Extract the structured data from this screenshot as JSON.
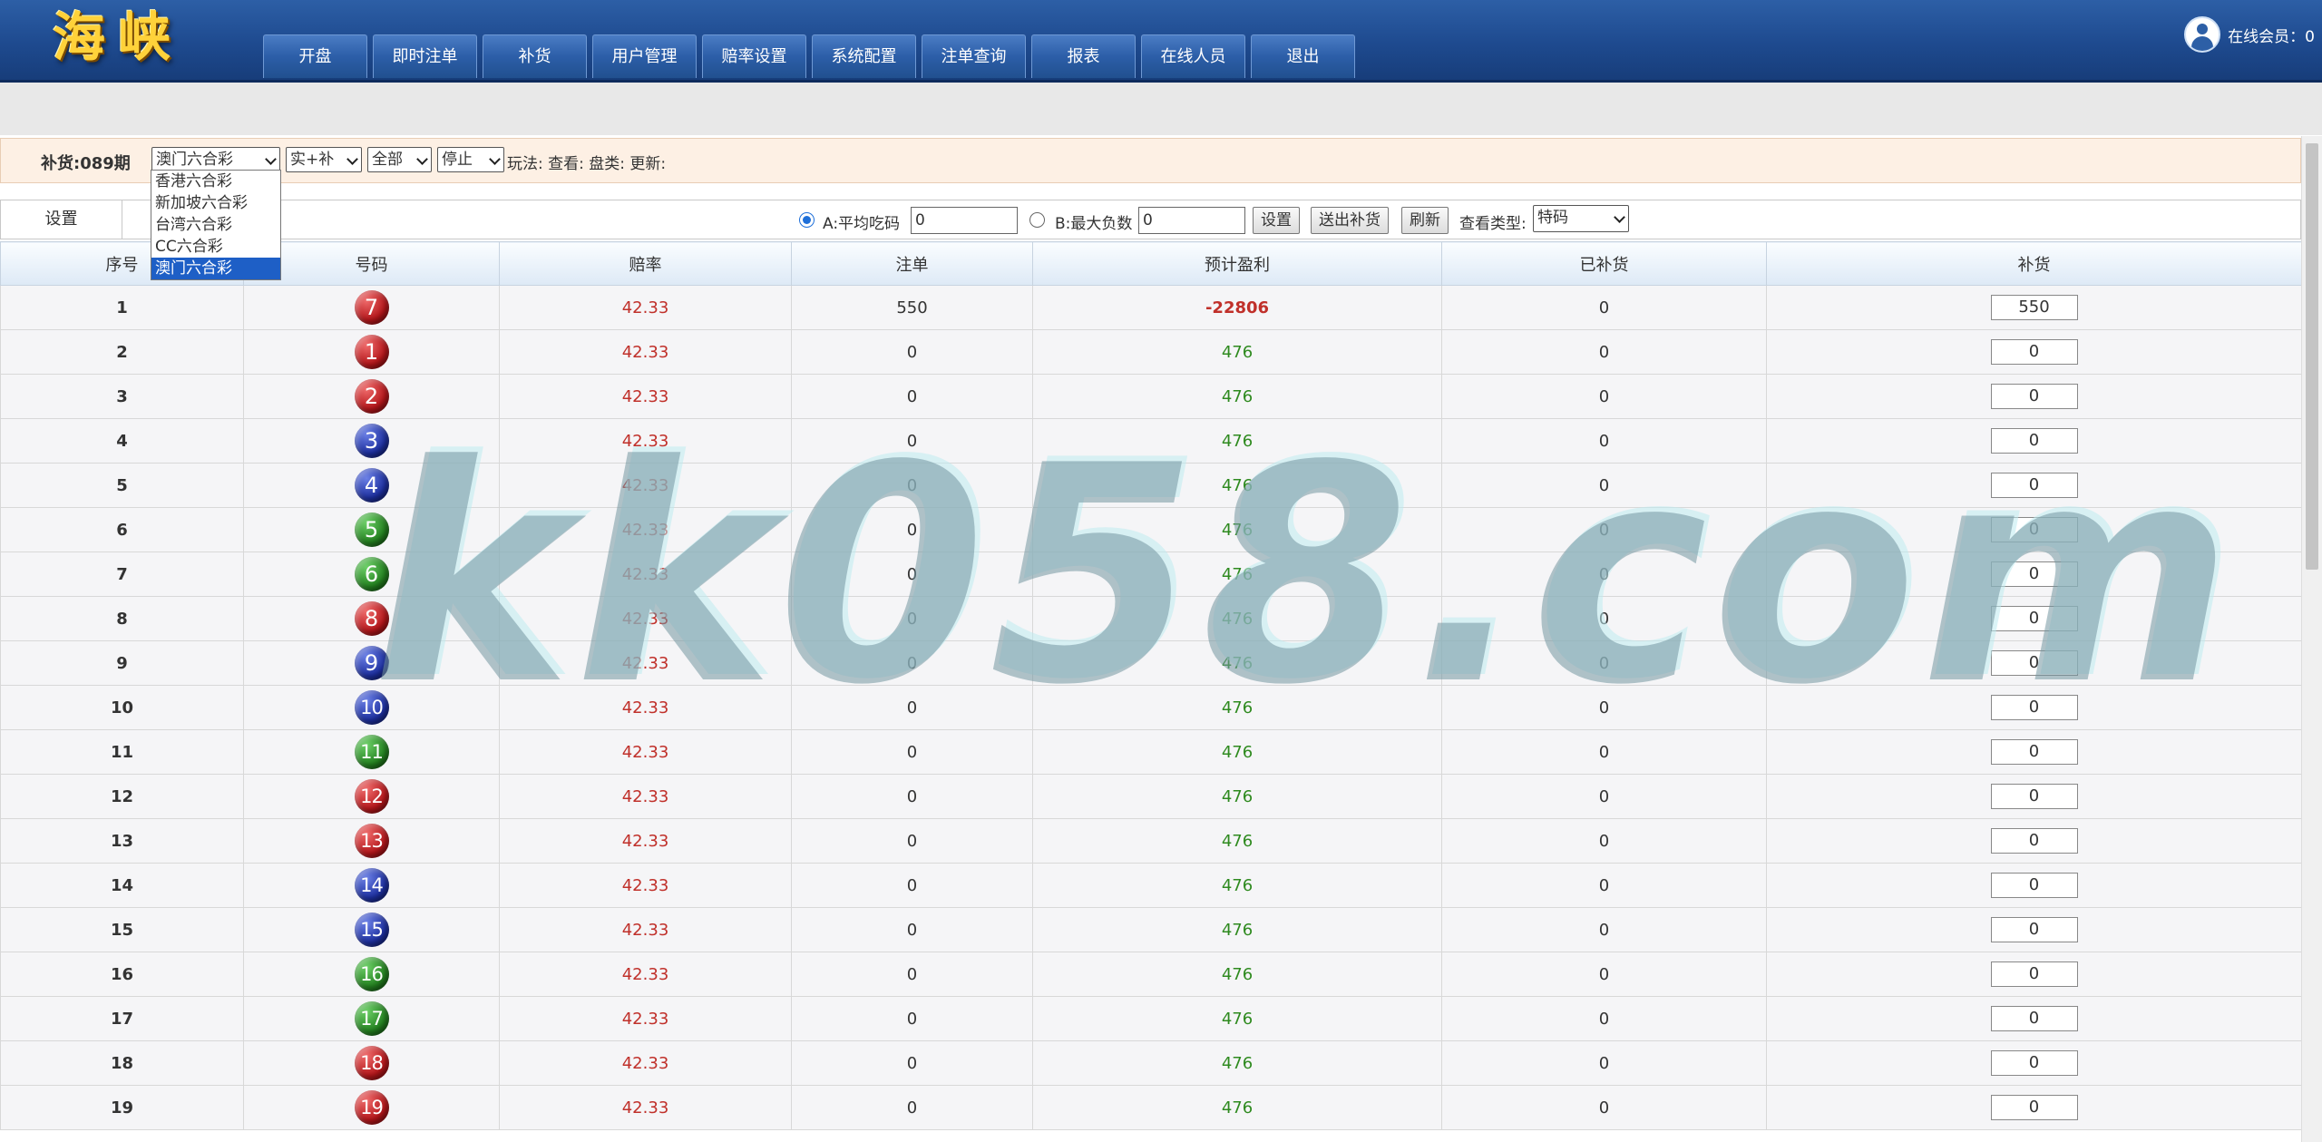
{
  "header": {
    "logo": "海峡",
    "nav": [
      "开盘",
      "即时注单",
      "补货",
      "用户管理",
      "赔率设置",
      "系统配置",
      "注单查询",
      "报表",
      "在线人员",
      "退出"
    ],
    "online_label": "在线会员：0"
  },
  "filter": {
    "period_label": "补货:089期",
    "lottery_selected": "澳门六合彩",
    "mode_selected": "实+补",
    "scope_selected": "全部",
    "status_selected": "停止",
    "info_text": "玩法: 查看: 盘类: 更新:",
    "lottery_options": [
      "香港六合彩",
      "新加坡六合彩",
      "台湾六合彩",
      "CC六合彩",
      "澳门六合彩"
    ]
  },
  "settings": {
    "label": "设置",
    "option_a_label": "A:平均吃码",
    "option_a_value": "0",
    "option_b_label": "B:最大负数",
    "option_b_value": "0",
    "set_button": "设置",
    "send_button": "送出补货",
    "refresh_button": "刷新",
    "view_type_label": "查看类型:",
    "view_type_selected": "特码"
  },
  "table": {
    "headers": [
      "序号",
      "号码",
      "赔率",
      "注单",
      "预计盈利",
      "已补货",
      "补货"
    ],
    "rows": [
      {
        "idx": "1",
        "num": "7",
        "color": "red",
        "odds": "42.33",
        "bets": "550",
        "profit": "-22806",
        "filled": "0",
        "fill": "550"
      },
      {
        "idx": "2",
        "num": "1",
        "color": "red",
        "odds": "42.33",
        "bets": "0",
        "profit": "476",
        "filled": "0",
        "fill": "0"
      },
      {
        "idx": "3",
        "num": "2",
        "color": "red",
        "odds": "42.33",
        "bets": "0",
        "profit": "476",
        "filled": "0",
        "fill": "0"
      },
      {
        "idx": "4",
        "num": "3",
        "color": "blue",
        "odds": "42.33",
        "bets": "0",
        "profit": "476",
        "filled": "0",
        "fill": "0"
      },
      {
        "idx": "5",
        "num": "4",
        "color": "blue",
        "odds": "42.33",
        "bets": "0",
        "profit": "476",
        "filled": "0",
        "fill": "0"
      },
      {
        "idx": "6",
        "num": "5",
        "color": "green",
        "odds": "42.33",
        "bets": "0",
        "profit": "476",
        "filled": "0",
        "fill": "0"
      },
      {
        "idx": "7",
        "num": "6",
        "color": "green",
        "odds": "42.33",
        "bets": "0",
        "profit": "476",
        "filled": "0",
        "fill": "0"
      },
      {
        "idx": "8",
        "num": "8",
        "color": "red",
        "odds": "42.33",
        "bets": "0",
        "profit": "476",
        "filled": "0",
        "fill": "0"
      },
      {
        "idx": "9",
        "num": "9",
        "color": "blue",
        "odds": "42.33",
        "bets": "0",
        "profit": "476",
        "filled": "0",
        "fill": "0"
      },
      {
        "idx": "10",
        "num": "10",
        "color": "blue",
        "odds": "42.33",
        "bets": "0",
        "profit": "476",
        "filled": "0",
        "fill": "0"
      },
      {
        "idx": "11",
        "num": "11",
        "color": "green",
        "odds": "42.33",
        "bets": "0",
        "profit": "476",
        "filled": "0",
        "fill": "0"
      },
      {
        "idx": "12",
        "num": "12",
        "color": "red",
        "odds": "42.33",
        "bets": "0",
        "profit": "476",
        "filled": "0",
        "fill": "0"
      },
      {
        "idx": "13",
        "num": "13",
        "color": "red",
        "odds": "42.33",
        "bets": "0",
        "profit": "476",
        "filled": "0",
        "fill": "0"
      },
      {
        "idx": "14",
        "num": "14",
        "color": "blue",
        "odds": "42.33",
        "bets": "0",
        "profit": "476",
        "filled": "0",
        "fill": "0"
      },
      {
        "idx": "15",
        "num": "15",
        "color": "blue",
        "odds": "42.33",
        "bets": "0",
        "profit": "476",
        "filled": "0",
        "fill": "0"
      },
      {
        "idx": "16",
        "num": "16",
        "color": "green",
        "odds": "42.33",
        "bets": "0",
        "profit": "476",
        "filled": "0",
        "fill": "0"
      },
      {
        "idx": "17",
        "num": "17",
        "color": "green",
        "odds": "42.33",
        "bets": "0",
        "profit": "476",
        "filled": "0",
        "fill": "0"
      },
      {
        "idx": "18",
        "num": "18",
        "color": "red",
        "odds": "42.33",
        "bets": "0",
        "profit": "476",
        "filled": "0",
        "fill": "0"
      },
      {
        "idx": "19",
        "num": "19",
        "color": "red",
        "odds": "42.33",
        "bets": "0",
        "profit": "476",
        "filled": "0",
        "fill": "0"
      }
    ]
  },
  "watermark": "kk058.com",
  "colors": {
    "header_blue": "#1e4a8f",
    "odds_red": "#c0302a",
    "profit_green": "#2e8a1f",
    "selected_option": "#1e5fc6"
  }
}
